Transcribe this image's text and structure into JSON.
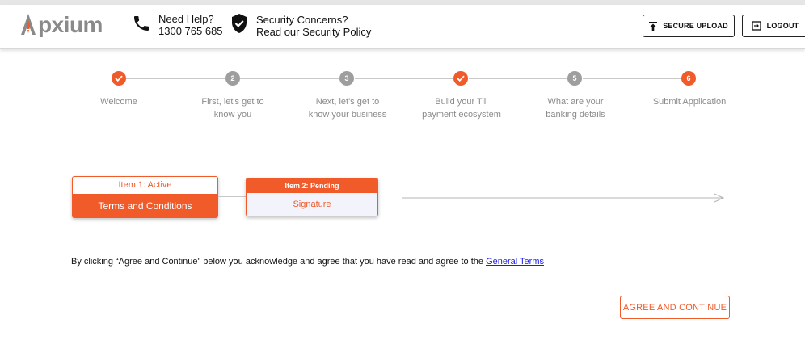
{
  "header": {
    "logo_text": "pxium",
    "help": {
      "line1": "Need Help?",
      "line2": "1300 765 685"
    },
    "security": {
      "line1": "Security Concerns?",
      "line2": "Read our Security Policy"
    },
    "upload_label": "SECURE UPLOAD",
    "logout_label": "LOGOUT"
  },
  "colors": {
    "accent": "#f15a29",
    "muted": "#9e9e9e",
    "text": "#111111"
  },
  "steps": [
    {
      "number": "",
      "status": "done",
      "line1": "Welcome",
      "line2": ""
    },
    {
      "number": "2",
      "status": "todo",
      "line1": "First, let's get to",
      "line2": "know you"
    },
    {
      "number": "3",
      "status": "todo",
      "line1": "Next, let's get to",
      "line2": "know your business"
    },
    {
      "number": "",
      "status": "done",
      "line1": "Build your Till",
      "line2": "payment ecosystem"
    },
    {
      "number": "5",
      "status": "todo",
      "line1": "What are your",
      "line2": "banking details"
    },
    {
      "number": "6",
      "status": "current",
      "line1": "Submit Application",
      "line2": ""
    }
  ],
  "items": {
    "item1": {
      "status": "Item 1: Active",
      "title": "Terms and Conditions"
    },
    "item2": {
      "status": "Item 2: Pending",
      "title": "Signature"
    }
  },
  "terms": {
    "text": "By clicking “Agree and Continue” below you acknowledge and agree that you have read and agree to the ",
    "link": "General Terms"
  },
  "agree_label": "AGREE AND CONTINUE"
}
